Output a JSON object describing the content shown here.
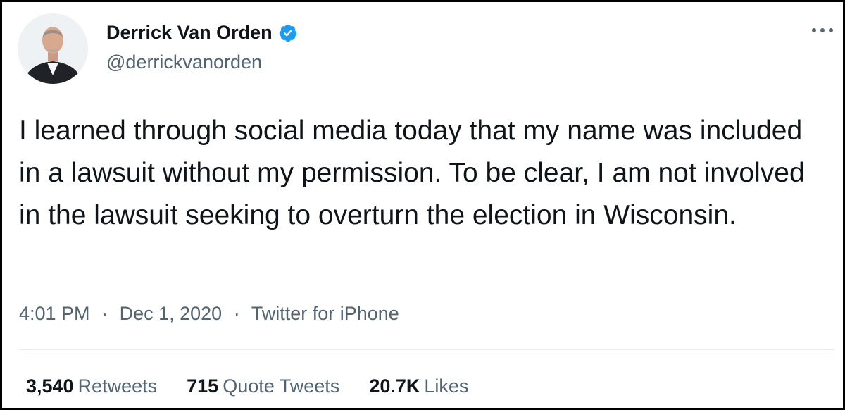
{
  "author": {
    "name": "Derrick Van Orden",
    "handle": "@derrickvanorden",
    "verified_icon": "verified-badge-icon",
    "verified_color": "#1d9bf0"
  },
  "tweet": {
    "text": "I learned through social media today that my name was included in a lawsuit without my permission. To be clear, I am not involved in the lawsuit seeking to overturn the election in Wisconsin."
  },
  "meta": {
    "time": "4:01 PM",
    "date": "Dec 1, 2020",
    "separator": "·",
    "source": "Twitter for iPhone"
  },
  "stats": {
    "retweets": {
      "count": "3,540",
      "label": "Retweets"
    },
    "quote_tweets": {
      "count": "715",
      "label": "Quote Tweets"
    },
    "likes": {
      "count": "20.7K",
      "label": "Likes"
    }
  },
  "colors": {
    "text": "#0f1419",
    "secondary": "#536471",
    "divider": "#e6ecf0"
  }
}
